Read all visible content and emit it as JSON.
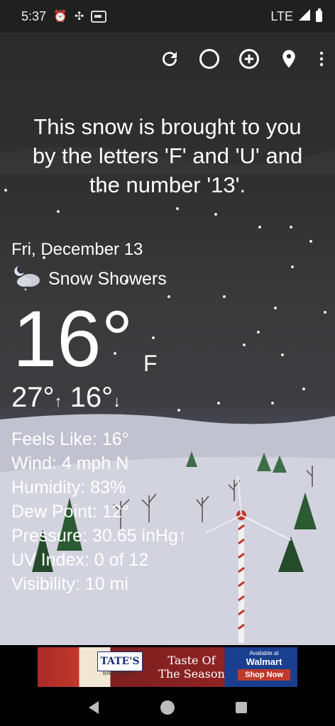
{
  "status_bar": {
    "time": "5:37",
    "network": "LTE",
    "icons": [
      "alarm-icon",
      "fan-icon",
      "gboard-icon",
      "signal-icon",
      "battery-icon"
    ]
  },
  "toolbar": {
    "buttons": [
      "refresh-icon",
      "theme-icon",
      "add-location-icon",
      "location-pin-icon",
      "more-vert-icon"
    ]
  },
  "banner": {
    "line1": "This snow is brought to you",
    "line2": "by the letters 'F' and 'U' and",
    "line3": "the number '13'."
  },
  "weather": {
    "date": "Fri, December 13",
    "condition": "Snow Showers",
    "condition_icon": "night-snow-cloud-icon",
    "temperature": "16°",
    "unit": "F",
    "high": "27°",
    "low": "16°",
    "high_arrow": "↑",
    "low_arrow": "↓"
  },
  "details": {
    "feels_like": "Feels Like:  16°",
    "wind": "Wind:  4 mph N",
    "humidity": "Humidity:  83%",
    "dew_point": "Dew Point:  12°",
    "pressure": "Pressure:  30.65 inHg↑",
    "uv_index": "UV Index:  0 of 12",
    "visibility": "Visibility:  10 mi"
  },
  "ad": {
    "brand": "TATE'S",
    "brand_sub": "BAKE SHOP",
    "headline_1": "Taste Of",
    "headline_2": "The Season",
    "available": "Available at",
    "retailer": "Walmart",
    "cta": "Shop Now"
  },
  "colors": {
    "status_bar_bg": "#202020",
    "sky": "#2b2b2b",
    "snow_ground": "#c9c8d6",
    "ad_red": "#8f2323",
    "ad_blue": "#1a3f8f"
  }
}
